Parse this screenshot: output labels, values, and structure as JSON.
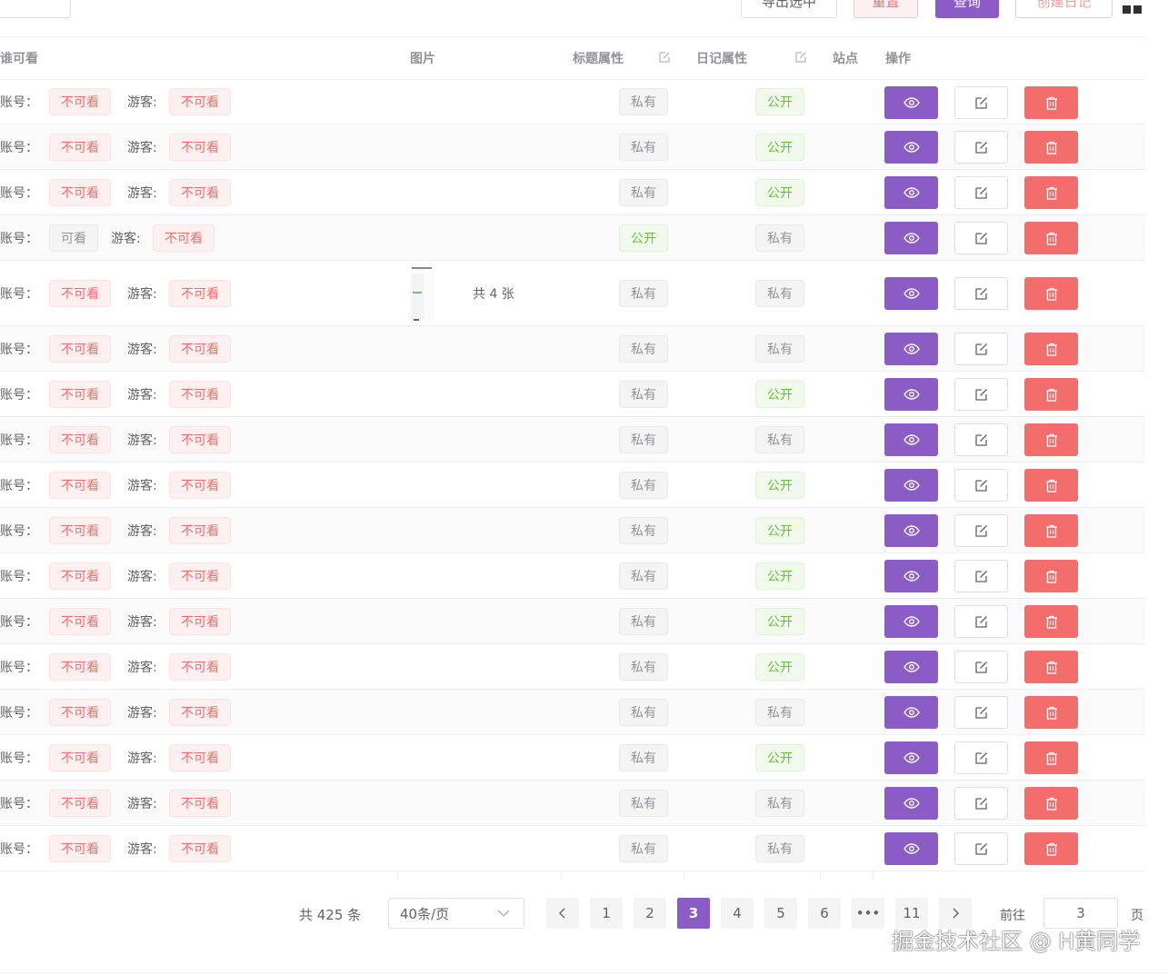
{
  "toolbar": {
    "export_label": "导出选中",
    "reset_label": "重置",
    "query_label": "查询",
    "create_label": "创建日记",
    "view_toggle_icon": "grid-icon"
  },
  "table": {
    "headers": {
      "visibility": "谁可看",
      "image": "图片",
      "title_attr": "标题属性",
      "diary_attr": "日记属性",
      "site": "站点",
      "actions": "操作"
    },
    "account_label": "账号：",
    "guest_label": "游客:",
    "rows": [
      {
        "account": "不可看",
        "account_type": "danger",
        "guest": "不可看",
        "title_attr": "私有",
        "title_type": "info",
        "diary_attr": "公开",
        "diary_type": "success",
        "image_count": ""
      },
      {
        "account": "不可看",
        "account_type": "danger",
        "guest": "不可看",
        "title_attr": "私有",
        "title_type": "info",
        "diary_attr": "公开",
        "diary_type": "success",
        "image_count": ""
      },
      {
        "account": "不可看",
        "account_type": "danger",
        "guest": "不可看",
        "title_attr": "私有",
        "title_type": "info",
        "diary_attr": "公开",
        "diary_type": "success",
        "image_count": ""
      },
      {
        "account": "可看",
        "account_type": "info",
        "guest": "不可看",
        "title_attr": "公开",
        "title_type": "success",
        "diary_attr": "私有",
        "diary_type": "info",
        "image_count": ""
      },
      {
        "account": "不可看",
        "account_type": "danger",
        "guest": "不可看",
        "title_attr": "私有",
        "title_type": "info",
        "diary_attr": "私有",
        "diary_type": "info",
        "image_count": "共 4 张"
      },
      {
        "account": "不可看",
        "account_type": "danger",
        "guest": "不可看",
        "title_attr": "私有",
        "title_type": "info",
        "diary_attr": "私有",
        "diary_type": "info",
        "image_count": ""
      },
      {
        "account": "不可看",
        "account_type": "danger",
        "guest": "不可看",
        "title_attr": "私有",
        "title_type": "info",
        "diary_attr": "公开",
        "diary_type": "success",
        "image_count": ""
      },
      {
        "account": "不可看",
        "account_type": "danger",
        "guest": "不可看",
        "title_attr": "私有",
        "title_type": "info",
        "diary_attr": "私有",
        "diary_type": "info",
        "image_count": ""
      },
      {
        "account": "不可看",
        "account_type": "danger",
        "guest": "不可看",
        "title_attr": "私有",
        "title_type": "info",
        "diary_attr": "公开",
        "diary_type": "success",
        "image_count": ""
      },
      {
        "account": "不可看",
        "account_type": "danger",
        "guest": "不可看",
        "title_attr": "私有",
        "title_type": "info",
        "diary_attr": "公开",
        "diary_type": "success",
        "image_count": ""
      },
      {
        "account": "不可看",
        "account_type": "danger",
        "guest": "不可看",
        "title_attr": "私有",
        "title_type": "info",
        "diary_attr": "公开",
        "diary_type": "success",
        "image_count": ""
      },
      {
        "account": "不可看",
        "account_type": "danger",
        "guest": "不可看",
        "title_attr": "私有",
        "title_type": "info",
        "diary_attr": "公开",
        "diary_type": "success",
        "image_count": ""
      },
      {
        "account": "不可看",
        "account_type": "danger",
        "guest": "不可看",
        "title_attr": "私有",
        "title_type": "info",
        "diary_attr": "公开",
        "diary_type": "success",
        "image_count": ""
      },
      {
        "account": "不可看",
        "account_type": "danger",
        "guest": "不可看",
        "title_attr": "私有",
        "title_type": "info",
        "diary_attr": "私有",
        "diary_type": "info",
        "image_count": ""
      },
      {
        "account": "不可看",
        "account_type": "danger",
        "guest": "不可看",
        "title_attr": "私有",
        "title_type": "info",
        "diary_attr": "公开",
        "diary_type": "success",
        "image_count": ""
      },
      {
        "account": "不可看",
        "account_type": "danger",
        "guest": "不可看",
        "title_attr": "私有",
        "title_type": "info",
        "diary_attr": "私有",
        "diary_type": "info",
        "image_count": ""
      },
      {
        "account": "不可看",
        "account_type": "danger",
        "guest": "不可看",
        "title_attr": "私有",
        "title_type": "info",
        "diary_attr": "私有",
        "diary_type": "info",
        "image_count": ""
      }
    ],
    "action_icons": [
      "eye-icon",
      "edit-icon",
      "trash-icon"
    ]
  },
  "pagination": {
    "total_text": "共 425 条",
    "page_size": "40条/页",
    "pages": [
      "1",
      "2",
      "3",
      "4",
      "5",
      "6",
      "•••",
      "11"
    ],
    "current_page": "3",
    "goto_label": "前往",
    "goto_value": "3",
    "page_suffix": "页"
  },
  "watermark": "掘金技术社区 @ H黄同学",
  "colors": {
    "primary": "#8b5cc5",
    "danger": "#f56c6c",
    "success": "#67c23a",
    "info": "#909399"
  }
}
